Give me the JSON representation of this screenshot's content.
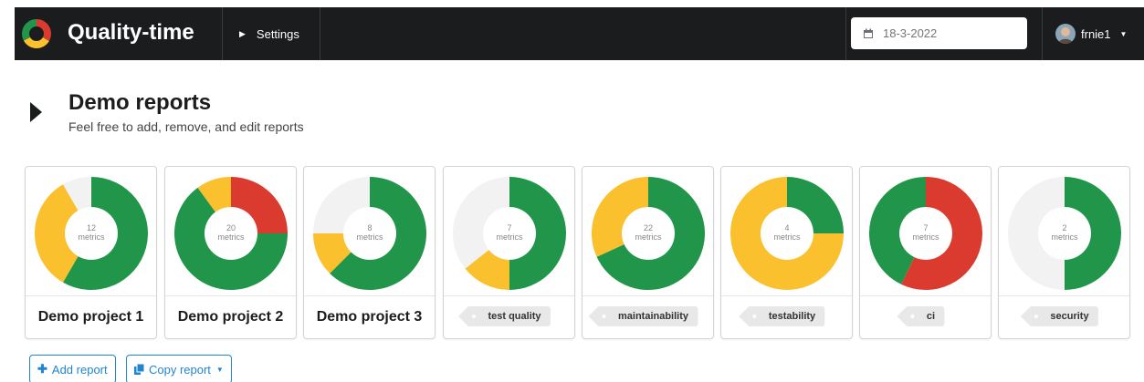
{
  "app": {
    "title": "Quality-time"
  },
  "nav": {
    "settings_label": "Settings"
  },
  "date": {
    "value": "18-3-2022"
  },
  "user": {
    "name": "frnie1"
  },
  "header": {
    "title": "Demo reports",
    "subtitle": "Feel free to add, remove, and edit reports"
  },
  "colors": {
    "green": "#21964b",
    "yellow": "#fbc02d",
    "red": "#db3a2f",
    "grey": "#f2f2f2",
    "accent": "#2185d0"
  },
  "cards": [
    {
      "count": "12",
      "unit": "metrics",
      "label": "Demo project 1",
      "kind": "report",
      "segments": [
        {
          "color": "green",
          "value": 7
        },
        {
          "color": "yellow",
          "value": 4
        },
        {
          "color": "grey",
          "value": 1
        }
      ]
    },
    {
      "count": "20",
      "unit": "metrics",
      "label": "Demo project 2",
      "kind": "report",
      "segments": [
        {
          "color": "red",
          "value": 5
        },
        {
          "color": "green",
          "value": 13
        },
        {
          "color": "yellow",
          "value": 2
        }
      ]
    },
    {
      "count": "8",
      "unit": "metrics",
      "label": "Demo project 3",
      "kind": "report",
      "segments": [
        {
          "color": "green",
          "value": 5
        },
        {
          "color": "yellow",
          "value": 1
        },
        {
          "color": "grey",
          "value": 2
        }
      ]
    },
    {
      "count": "7",
      "unit": "metrics",
      "label": "test quality",
      "kind": "tag",
      "segments": [
        {
          "color": "green",
          "value": 3.5
        },
        {
          "color": "yellow",
          "value": 1
        },
        {
          "color": "grey",
          "value": 2.5
        }
      ]
    },
    {
      "count": "22",
      "unit": "metrics",
      "label": "maintainability",
      "kind": "tag",
      "segments": [
        {
          "color": "green",
          "value": 15
        },
        {
          "color": "yellow",
          "value": 7
        }
      ]
    },
    {
      "count": "4",
      "unit": "metrics",
      "label": "testability",
      "kind": "tag",
      "segments": [
        {
          "color": "green",
          "value": 1
        },
        {
          "color": "yellow",
          "value": 3
        }
      ]
    },
    {
      "count": "7",
      "unit": "metrics",
      "label": "ci",
      "kind": "tag",
      "segments": [
        {
          "color": "red",
          "value": 4
        },
        {
          "color": "green",
          "value": 3
        }
      ]
    },
    {
      "count": "2",
      "unit": "metrics",
      "label": "security",
      "kind": "tag",
      "segments": [
        {
          "color": "green",
          "value": 1
        },
        {
          "color": "grey",
          "value": 1
        }
      ]
    }
  ],
  "actions": {
    "add_report": "Add report",
    "copy_report": "Copy report"
  },
  "icons": {
    "logo": "quality-time-logo",
    "settings_caret": "caret-right-icon",
    "calendar": "calendar-icon",
    "user_dropdown": "chevron-down-icon",
    "toggle": "caret-right-icon",
    "add": "plus-icon",
    "copy": "copy-icon"
  }
}
